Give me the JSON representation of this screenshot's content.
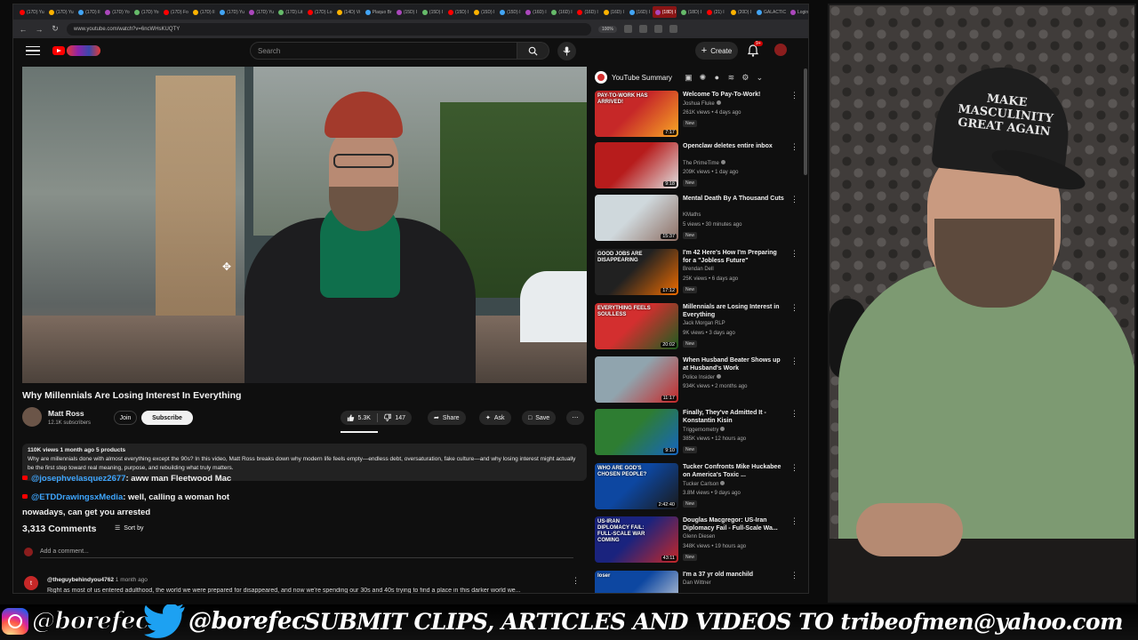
{
  "browser": {
    "tabs": [
      "(17D) Yu",
      "(17D) Yu",
      "(17D) Il",
      "(17D) Yo",
      "(17D) Yo",
      "(17D) Fo",
      "(17D) Il",
      "(17D) Yu",
      "(17D) Yu",
      "(17D) Lit",
      "(17D) Lo",
      "(14D) Vi",
      "Plaquo Br",
      "(15D) I",
      "(15D) I",
      "(15D) I",
      "(15D) I",
      "(15D) I",
      "(16D) I",
      "(16D) I",
      "(16D) I",
      "(16D) I",
      "(16D) I",
      "(18D) I",
      "(18D) I",
      "(21) I",
      "(20D) I",
      "GALACTIC",
      "Login"
    ],
    "active_tab_index": 23,
    "url": "www.youtube.com/watch?v=6ncWHsKUQTY",
    "zoom": "100%"
  },
  "header": {
    "search_placeholder": "Search",
    "create_label": "Create",
    "notifications": "9+"
  },
  "video": {
    "title": "Why Millennials Are Losing Interest In Everything",
    "channel": "Matt Ross",
    "subscribers": "12.1K subscribers",
    "join_label": "Join",
    "subscribe_label": "Subscribe",
    "likes": "5.3K",
    "dislikes": "147",
    "share_label": "Share",
    "ask_label": "Ask",
    "save_label": "Save"
  },
  "description": {
    "meta": "110K views  1 month ago  5 products",
    "text": "Why are millennials done with almost everything except the 90s? In this video, Matt Ross breaks down why modern life feels empty—endless debt, oversaturation, fake culture—and why losing interest might actually be the first step toward real meaning, purpose, and rebuilding what truly matters."
  },
  "chat": [
    {
      "user": "@josephvelasquez2677",
      "message": ": aww man Fleetwood Mac"
    },
    {
      "user": "@ETDDrawingsxMedia",
      "message": ": well, calling a woman hot"
    },
    {
      "user": "",
      "message": "nowadays, can get you arrested"
    }
  ],
  "comments": {
    "count": "3,313 Comments",
    "sort_label": "Sort by",
    "add_placeholder": "Add a comment...",
    "first": {
      "avatar_letter": "t",
      "user": "@theguybehindyou4762",
      "time": "1 month ago",
      "text": "Right as most of us entered adulthood, the world we were prepared for disappeared, and now we're spending our 30s and 40s trying to find a place in this darker world we..."
    }
  },
  "sidebar": {
    "title": "YouTube Summary",
    "items": [
      {
        "title": "Welcome To Pay-To-Work!",
        "channel": "Joshua Fluke",
        "verified": true,
        "stats": "261K views • 4 days ago",
        "badge": "New",
        "duration": "7:17",
        "thumb_colors": [
          "#c62828",
          "#f9a825"
        ],
        "thumb_text": "PAY-TO-WORK HAS ARRIVED!"
      },
      {
        "title": "Openclaw deletes entire inbox",
        "channel": "The PrimeTime",
        "verified": true,
        "stats": "209K views • 1 day ago",
        "badge": "New",
        "duration": "9:18",
        "thumb_colors": [
          "#b71c1c",
          "#e0e0e0"
        ],
        "thumb_text": ""
      },
      {
        "title": "Mental Death By A Thousand Cuts",
        "channel": "KMaths",
        "verified": false,
        "stats": "5 views • 30 minutes ago",
        "badge": "New",
        "duration": "15:37",
        "thumb_colors": [
          "#cfd8dc",
          "#8d6e63"
        ],
        "thumb_text": ""
      },
      {
        "title": "I'm 42  Here's How I'm Preparing for a \"Jobless Future\"",
        "channel": "Brendan Dell",
        "verified": false,
        "stats": "25K views • 6 days ago",
        "badge": "New",
        "duration": "17:12",
        "thumb_colors": [
          "#212121",
          "#ef6c00"
        ],
        "thumb_text": "GOOD JOBS ARE DISAPPEARING"
      },
      {
        "title": "Millennials are Losing Interest in Everything",
        "channel": "Jack Morgan RLP",
        "verified": false,
        "stats": "9K views • 3 days ago",
        "badge": "New",
        "duration": "20:02",
        "thumb_colors": [
          "#d32f2f",
          "#1b5e20"
        ],
        "thumb_text": "EVERYTHING FEELS SOULLESS"
      },
      {
        "title": "When Husband Beater Shows up at Husband's Work",
        "channel": "Police Insider",
        "verified": true,
        "stats": "934K views • 2 months ago",
        "badge": "",
        "duration": "11:17",
        "thumb_colors": [
          "#90a4ae",
          "#c62828"
        ],
        "thumb_text": ""
      },
      {
        "title": "Finally, They've Admitted It - Konstantin Kisin",
        "channel": "Triggernometry",
        "verified": true,
        "stats": "385K views • 12 hours ago",
        "badge": "New",
        "duration": "9:10",
        "thumb_colors": [
          "#2e7d32",
          "#1565c0"
        ],
        "thumb_text": ""
      },
      {
        "title": "Tucker Confronts Mike Huckabee on America's Toxic ...",
        "channel": "Tucker Carlson",
        "verified": true,
        "stats": "3.8M views • 9 days ago",
        "badge": "New",
        "duration": "2:42:40",
        "thumb_colors": [
          "#0d47a1",
          "#1a1a1a"
        ],
        "thumb_text": "WHO ARE GOD'S CHOSEN PEOPLE?"
      },
      {
        "title": "Douglas Macgregor: US-Iran Diplomacy Fail - Full-Scale Wa...",
        "channel": "Glenn Diesen",
        "verified": false,
        "stats": "348K views • 19 hours ago",
        "badge": "New",
        "duration": "43:11",
        "thumb_colors": [
          "#1a237e",
          "#c62828"
        ],
        "thumb_text": "US-IRAN DIPLOMACY FAIL: FULL-SCALE WAR COMING"
      },
      {
        "title": "I'm a 37 yr old manchild",
        "channel": "Dan Wittner",
        "verified": false,
        "stats": "",
        "badge": "",
        "duration": "",
        "thumb_colors": [
          "#0d47a1",
          "#e0e0e0"
        ],
        "thumb_text": "loser"
      }
    ]
  },
  "webcam": {
    "cap_text": "MAKE MASCULINITY GREAT AGAIN"
  },
  "banner": {
    "instagram": "@borefec",
    "twitter": "@borefec",
    "text": "SUBMIT CLIPS, ARTICLES AND VIDEOS TO tribeofmen@yahoo.com"
  },
  "colors": {
    "yt_red": "#ff0000",
    "link_blue": "#3ea6ff",
    "bg": "#0f0f0f"
  }
}
